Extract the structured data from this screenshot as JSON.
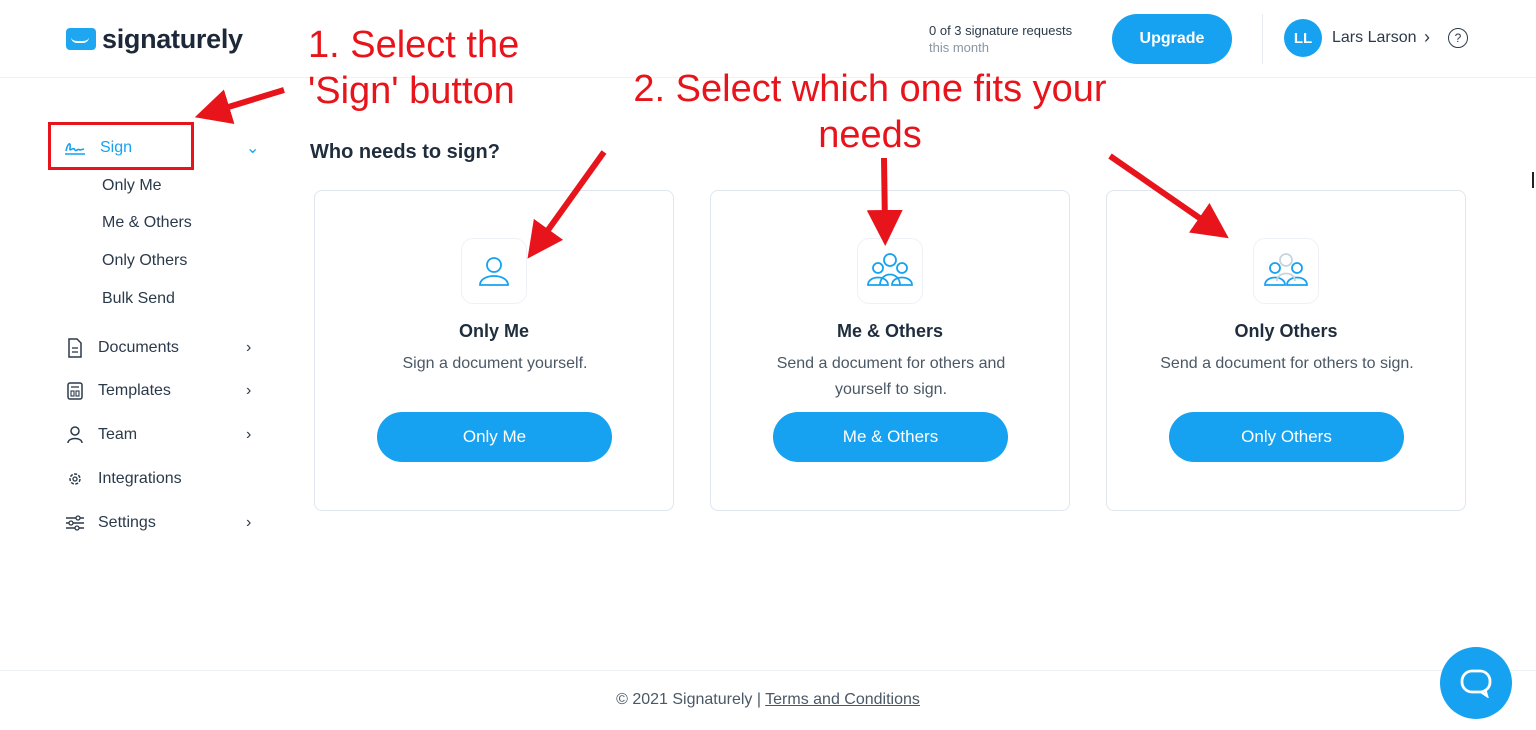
{
  "header": {
    "logo_text": "signaturely",
    "usage_line1": "0 of 3 signature requests",
    "usage_line2": "this month",
    "upgrade_label": "Upgrade",
    "avatar_initials": "LL",
    "user_name": "Lars Larson"
  },
  "sidebar": {
    "sign": {
      "label": "Sign",
      "sub_items": [
        "Only Me",
        "Me & Others",
        "Only Others",
        "Bulk Send"
      ]
    },
    "items": [
      {
        "label": "Documents",
        "icon": "document-icon"
      },
      {
        "label": "Templates",
        "icon": "calculator-icon"
      },
      {
        "label": "Team",
        "icon": "user-icon"
      },
      {
        "label": "Integrations",
        "icon": "gear-icon"
      },
      {
        "label": "Settings",
        "icon": "sliders-icon"
      }
    ]
  },
  "main": {
    "title": "Who needs to sign?",
    "cards": [
      {
        "title": "Only Me",
        "description": "Sign a document yourself.",
        "button": "Only Me",
        "icon": "single-user-icon"
      },
      {
        "title": "Me & Others",
        "description": "Send a document for others and yourself to sign.",
        "button": "Me & Others",
        "icon": "group-users-icon"
      },
      {
        "title": "Only Others",
        "description": "Send a document for others to sign.",
        "button": "Only Others",
        "icon": "others-users-icon"
      }
    ]
  },
  "annotations": {
    "step1": "1. Select the 'Sign' button",
    "step2": "2. Select which one fits your needs",
    "color": "#e8141b"
  },
  "footer": {
    "copyright": "© 2021 Signaturely |",
    "terms_link": "Terms and Conditions"
  },
  "colors": {
    "accent": "#16a2f0",
    "text": "#1f2d3d"
  }
}
